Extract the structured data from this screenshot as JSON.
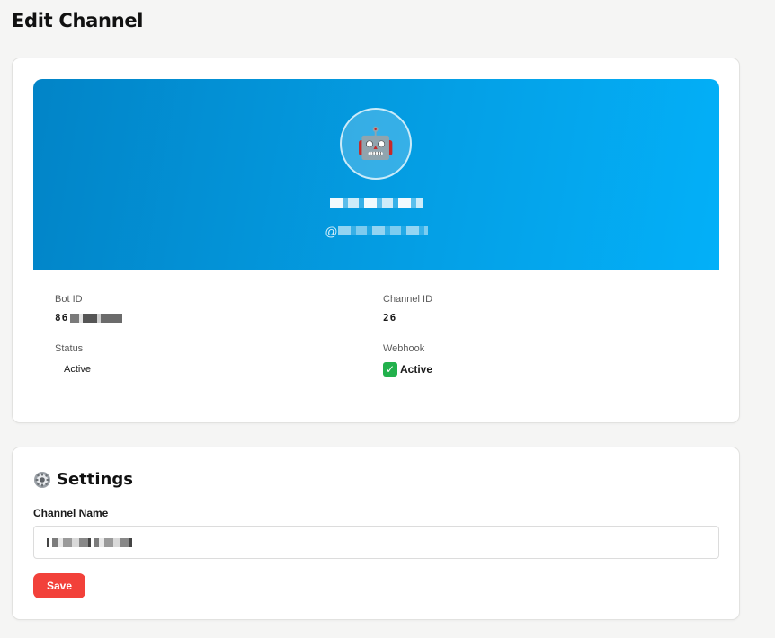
{
  "page": {
    "title": "Edit Channel"
  },
  "profile": {
    "avatar_emoji": "🤖",
    "name": "",
    "handle_prefix": "@"
  },
  "details": {
    "bot_id_label": "Bot ID",
    "bot_id_value": "86",
    "channel_id_label": "Channel ID",
    "channel_id_value": "26",
    "status_label": "Status",
    "status_value": "Active",
    "webhook_label": "Webhook",
    "webhook_value": "Active",
    "webhook_icon": "check-icon"
  },
  "settings": {
    "title": "Settings",
    "channel_name_label": "Channel Name",
    "channel_name_value": "",
    "save_label": "Save"
  },
  "colors": {
    "banner_start": "#0284c7",
    "banner_end": "#03b0f8",
    "save_button": "#f2413a",
    "webhook_check": "#22b14c"
  }
}
